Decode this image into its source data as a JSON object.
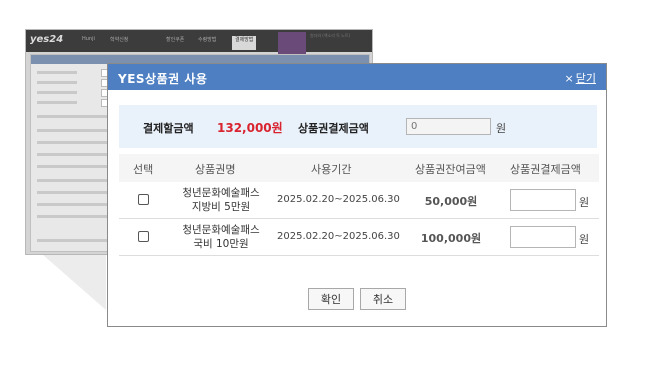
{
  "background_page": {
    "logo": "yes24",
    "tabs": [
      "Hunji",
      "학약신청",
      "할인쿠폰",
      "수령방법",
      "결제방법"
    ],
    "promo_text": "원자와 (책소리 독 노트)"
  },
  "dialog": {
    "title": "YES상품권 사용",
    "close_label": "닫기",
    "close_icon": "×",
    "summary": {
      "pay_amount_label": "결제할금액",
      "pay_amount_value": "132,000원",
      "voucher_amount_label": "상품권결제금액",
      "voucher_amount_placeholder": "0",
      "unit": "원"
    },
    "table": {
      "headers": [
        "선택",
        "상품권명",
        "사용기간",
        "상품권잔여금액",
        "상품권결제금액"
      ],
      "rows": [
        {
          "name": "청년문화예술패스 지방비 5만원",
          "period": "2025.02.20~2025.06.30",
          "balance": "50,000원",
          "unit": "원"
        },
        {
          "name": "청년문화예술패스 국비 10만원",
          "period": "2025.02.20~2025.06.30",
          "balance": "100,000원",
          "unit": "원"
        }
      ]
    },
    "buttons": {
      "confirm": "확인",
      "cancel": "취소"
    }
  },
  "colors": {
    "header_blue": "#4d7fc2",
    "amount_red": "#d9232f",
    "summary_bg": "#e9f1fa"
  }
}
